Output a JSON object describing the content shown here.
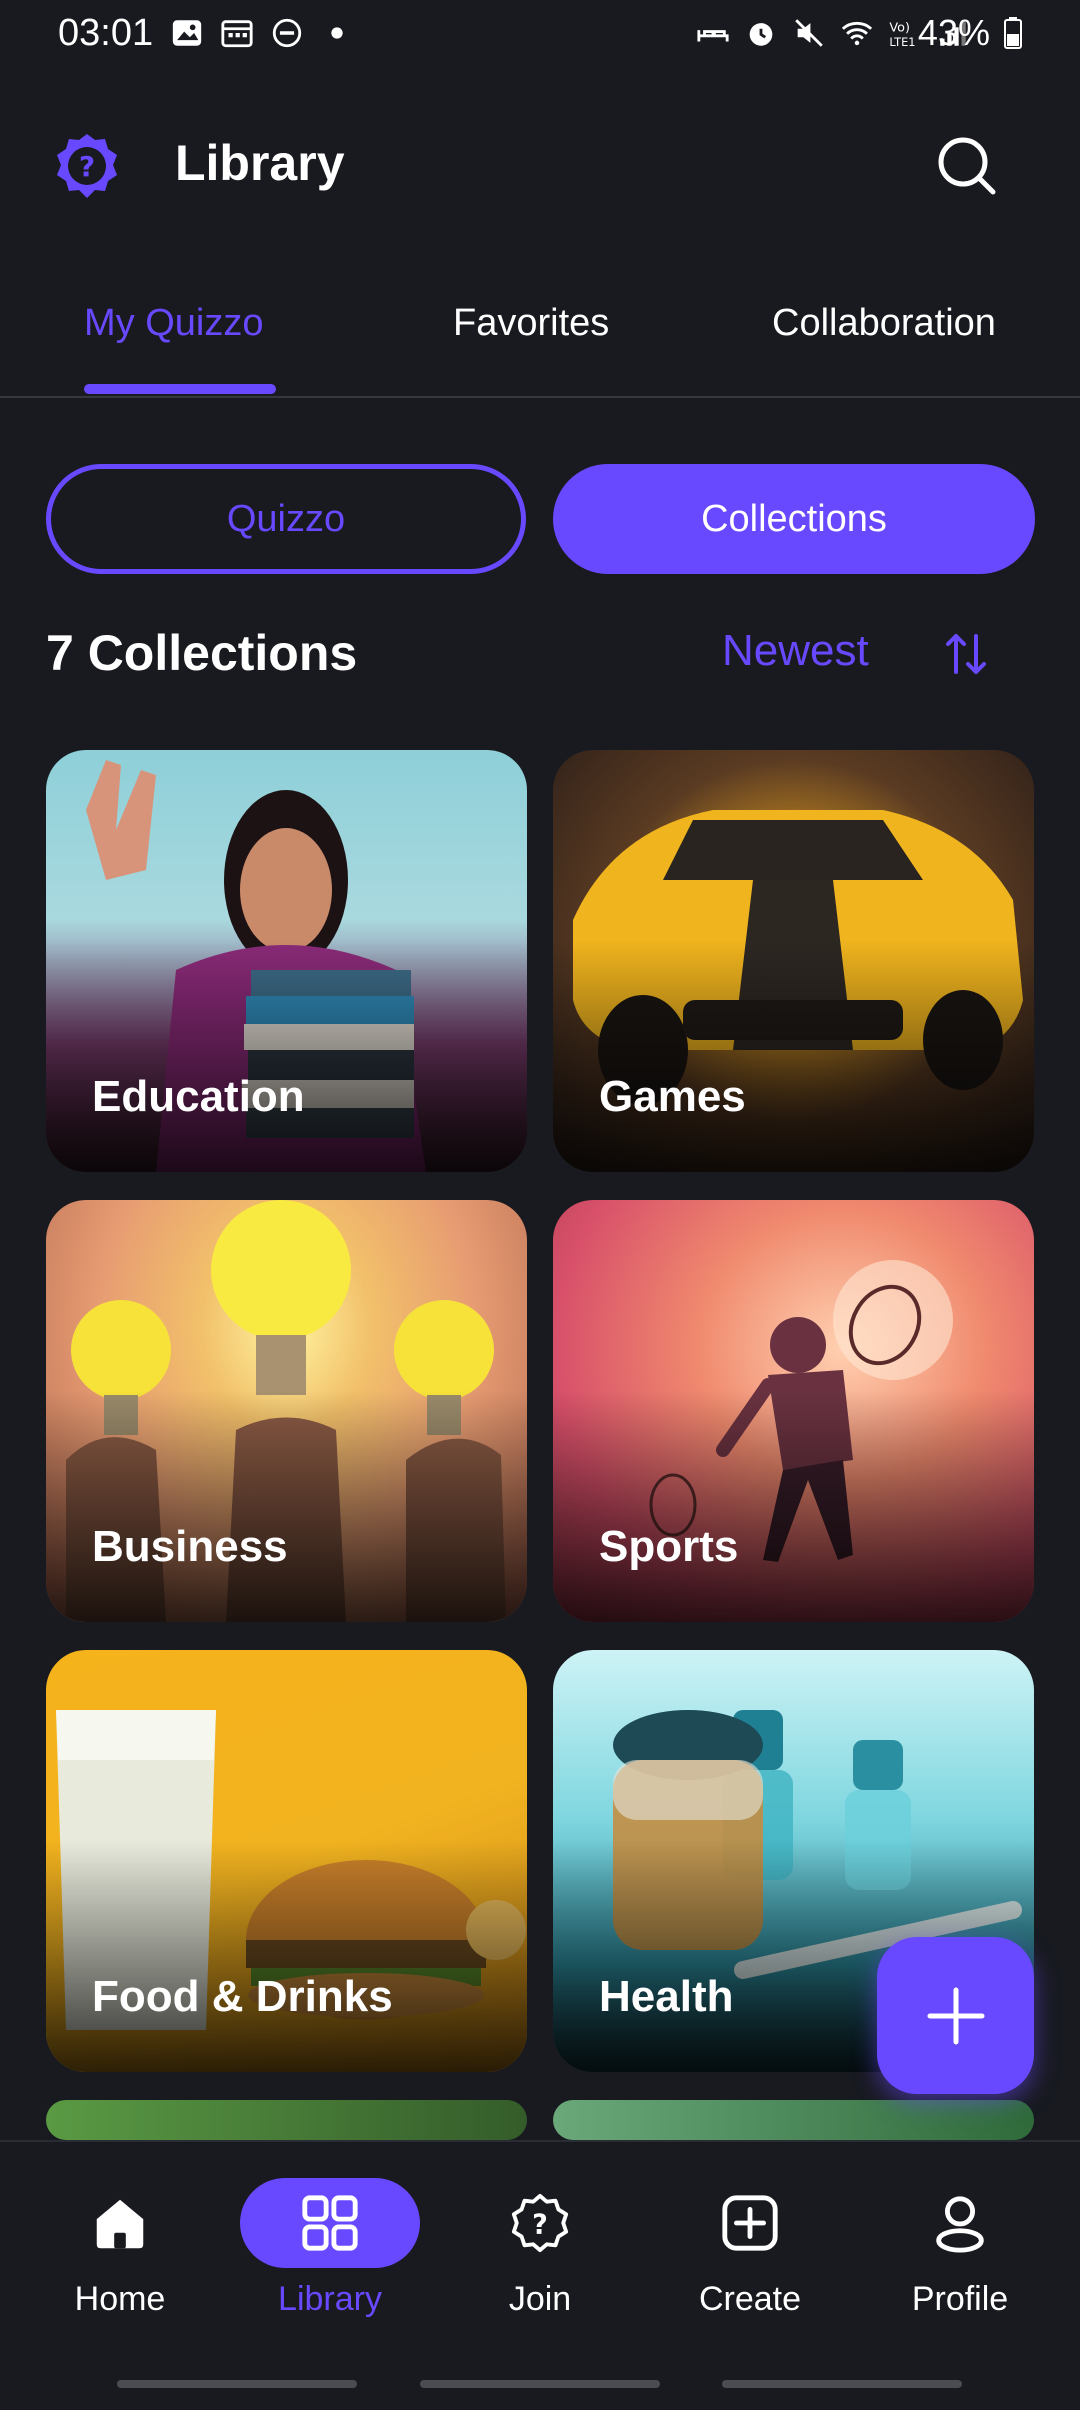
{
  "status_bar": {
    "time": "03:01",
    "battery": "43%"
  },
  "header": {
    "title": "Library"
  },
  "tabs": [
    {
      "label": "My Quizzo",
      "active": true
    },
    {
      "label": "Favorites",
      "active": false
    },
    {
      "label": "Collaboration",
      "active": false
    }
  ],
  "segmented": {
    "quizzo_label": "Quizzo",
    "collections_label": "Collections",
    "selected": "Collections"
  },
  "list_header": {
    "count_label": "7 Collections",
    "sort_label": "Newest"
  },
  "collections": [
    {
      "label": "Education"
    },
    {
      "label": "Games"
    },
    {
      "label": "Business"
    },
    {
      "label": "Sports"
    },
    {
      "label": "Food & Drinks"
    },
    {
      "label": "Health"
    }
  ],
  "bottom_nav": [
    {
      "label": "Home",
      "icon": "home-icon",
      "active": false
    },
    {
      "label": "Library",
      "icon": "grid-icon",
      "active": true
    },
    {
      "label": "Join",
      "icon": "join-icon",
      "active": false
    },
    {
      "label": "Create",
      "icon": "create-icon",
      "active": false
    },
    {
      "label": "Profile",
      "icon": "profile-icon",
      "active": false
    }
  ],
  "colors": {
    "accent": "#6949FF",
    "background": "#181A20"
  }
}
